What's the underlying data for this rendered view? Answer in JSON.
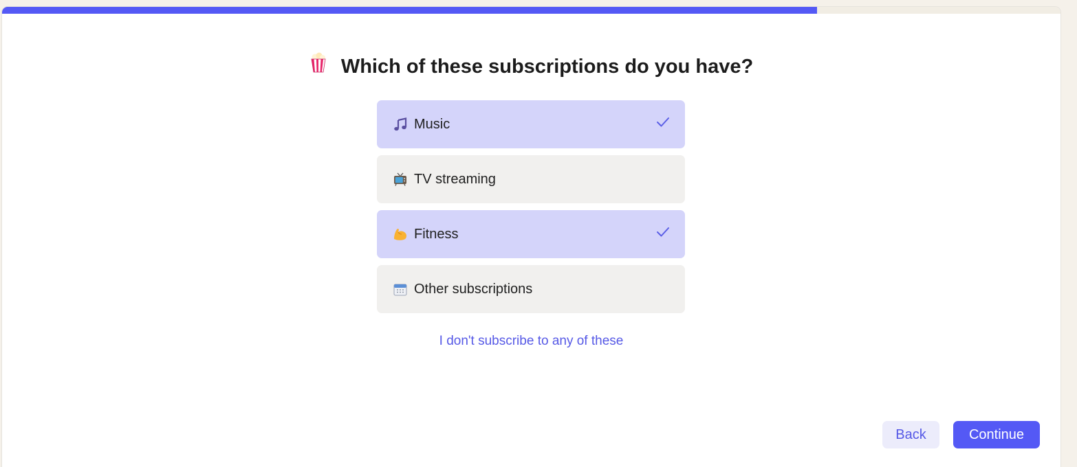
{
  "progress": {
    "fraction": 0.77
  },
  "question": {
    "icon": "popcorn-icon",
    "title": "Which of these subscriptions do you have?"
  },
  "options": [
    {
      "icon": "musical-notes-icon",
      "label": "Music",
      "selected": true
    },
    {
      "icon": "tv-icon",
      "label": "TV streaming",
      "selected": false
    },
    {
      "icon": "flexed-biceps-icon",
      "label": "Fitness",
      "selected": true
    },
    {
      "icon": "calendar-icon",
      "label": "Other subscriptions",
      "selected": false
    }
  ],
  "none_link": "I don't subscribe to any of these",
  "buttons": {
    "back": "Back",
    "continue": "Continue"
  },
  "colors": {
    "accent": "#5459f5",
    "selected_bg": "#d4d4fa",
    "unselected_bg": "#f1f0ee",
    "link": "#5659e6"
  }
}
